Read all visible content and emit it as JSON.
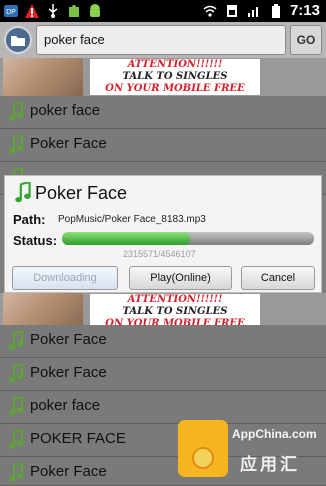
{
  "status_bar": {
    "time": "7:13",
    "left_icons": [
      "app-icon",
      "warning-icon",
      "usb-icon",
      "puzzle-icon",
      "android-icon"
    ],
    "right_icons": [
      "wifi-icon",
      "sim-icon",
      "signal-icon",
      "battery-icon"
    ]
  },
  "search": {
    "value": "poker face",
    "go_label": "GO"
  },
  "ads": [
    {
      "line1": "ATTENTION!!!!!!",
      "line2": "TALK TO SINGLES",
      "line3": "ON YOUR MOBILE FREE"
    },
    {
      "line1": "ATTENTION!!!!!!",
      "line2": "TALK TO SINGLES",
      "line3": "ON YOUR MOBILE FREE"
    }
  ],
  "list_top": [
    {
      "title": "poker face"
    },
    {
      "title": "Poker Face"
    }
  ],
  "list_bottom": [
    {
      "title": "Poker Face"
    },
    {
      "title": "Poker Face"
    },
    {
      "title": "poker face"
    },
    {
      "title": "POKER FACE"
    },
    {
      "title": "Poker Face"
    }
  ],
  "dialog": {
    "title": "Poker Face",
    "path_label": "Path:",
    "path_value": "PopMusic/Poker Face_8183.mp3",
    "status_label": "Status:",
    "progress": 0.5066,
    "progress_text": "2315571/4546107",
    "buttons": {
      "downloading": "Downloading",
      "play": "Play(Online)",
      "cancel": "Cancel"
    }
  },
  "watermark": {
    "text1": "AppChina.com",
    "text2": "应用汇"
  },
  "colors": {
    "accent_green": "#32a62e",
    "overlay_gray": "#7f7f7f"
  }
}
